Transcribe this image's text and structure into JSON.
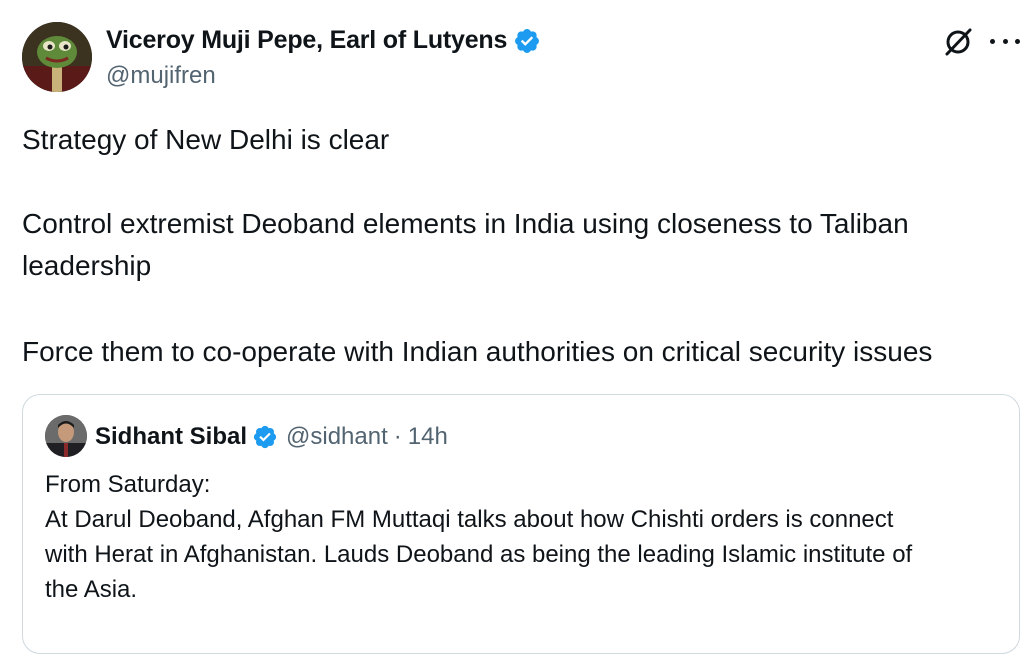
{
  "tweet": {
    "author": {
      "display_name": "Viceroy Muji Pepe, Earl of Lutyens",
      "handle": "@mujifren",
      "verified": true
    },
    "paragraphs": {
      "p1": "Strategy of New Delhi is clear",
      "p2_line1": "Control extremist Deoband elements in India using closeness to Taliban",
      "p2_line2": "leadership",
      "p3": "Force them to co-operate with Indian authorities on critical security issues"
    },
    "icons": {
      "grok": "grok-icon",
      "more": "more-options-icon",
      "verified": "verified-badge-icon"
    }
  },
  "quote": {
    "author": {
      "display_name": "Sidhant Sibal",
      "handle": "@sidhant",
      "separator": "·",
      "time": "14h",
      "verified": true
    },
    "lines": {
      "l1": "From Saturday:",
      "l2": "At Darul Deoband, Afghan FM Muttaqi talks about how Chishti orders is connect",
      "l3": "with Herat in Afghanistan. Lauds Deoband as being the leading Islamic institute of",
      "l4": "the Asia."
    }
  },
  "colors": {
    "text_primary": "#0f1419",
    "text_secondary": "#536471",
    "verified_blue": "#1d9bf0",
    "border": "#cfd9de"
  }
}
